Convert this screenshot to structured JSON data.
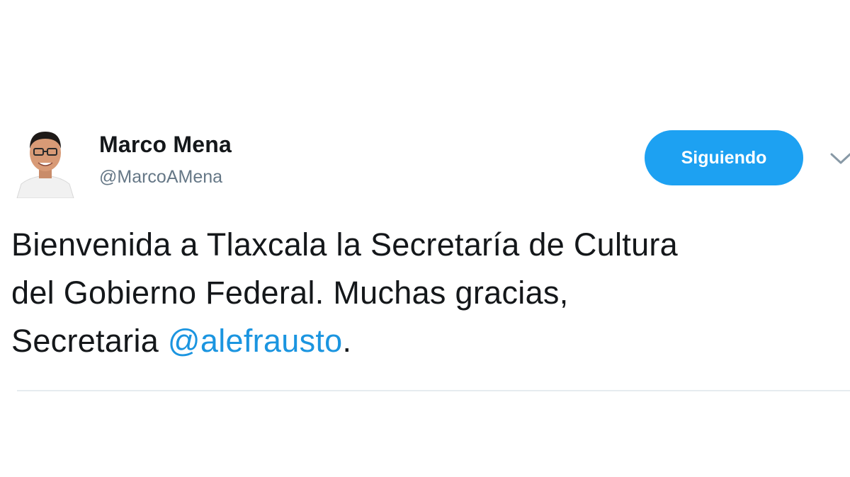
{
  "user": {
    "display_name": "Marco Mena",
    "handle": "@MarcoAMena"
  },
  "follow_button": {
    "label": "Siguiendo"
  },
  "tweet": {
    "text_before": "Bienvenida a Tlaxcala la Secretaría de Cultura\ndel Gobierno Federal. Muchas gracias,\nSecretaria ",
    "mention": "@alefrausto",
    "text_after": "."
  },
  "icons": {
    "avatar": "profile-photo",
    "menu": "chevron-down-icon"
  },
  "colors": {
    "accent": "#1da1f2",
    "mention": "#1b95e0",
    "text": "#14171a",
    "secondary_text": "#657786"
  }
}
